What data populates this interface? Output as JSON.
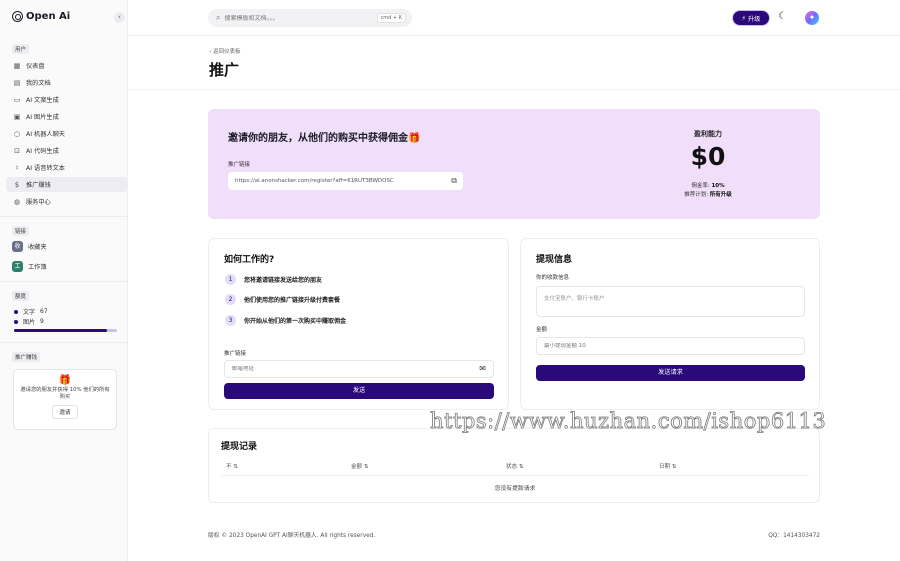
{
  "app": {
    "logo_text": "Open Ai"
  },
  "sidebar": {
    "section_user": "用户",
    "items": [
      {
        "label": "仪表盘",
        "icon": "grid-icon"
      },
      {
        "label": "我的文档",
        "icon": "archive-icon"
      },
      {
        "label": "AI 文案生成",
        "icon": "document-icon"
      },
      {
        "label": "AI 图片生成",
        "icon": "image-icon"
      },
      {
        "label": "AI 机器人聊天",
        "icon": "chat-icon"
      },
      {
        "label": "AI 代码生成",
        "icon": "code-icon"
      },
      {
        "label": "AI 语音转文本",
        "icon": "mic-icon"
      },
      {
        "label": "推广赚钱",
        "icon": "dollar-icon",
        "active": true
      },
      {
        "label": "服务中心",
        "icon": "globe-icon"
      }
    ],
    "section_workspace": "链接",
    "workspace": [
      {
        "label": "收藏夹",
        "initial": "收",
        "color": "#6a6f8a"
      },
      {
        "label": "工作簿",
        "initial": "工",
        "color": "#2f7f6e"
      }
    ],
    "section_usage": "额度",
    "usage": {
      "words_label": "文字",
      "words_value": "67",
      "images_label": "图片",
      "images_value": "9",
      "fill_fraction": 0.9
    },
    "section_promo": "推广赚钱",
    "promo": {
      "text": "邀请您的朋友并获得 10% 他们的所有购买",
      "button": "邀请"
    }
  },
  "topbar": {
    "search_placeholder": "搜索模板和文档。。。",
    "shortcut": "cmd + K",
    "upgrade_label": "升级"
  },
  "page": {
    "back_link": "返回仪表板",
    "title": "推广"
  },
  "hero": {
    "title": "邀请你的朋友，从他们的购买中获得佣金🎁",
    "link_label": "推广链接",
    "link_value": "https://ai.anonshacker.com/register?aff=61RUT3BWDOSC",
    "earnings_label": "盈利能力",
    "earnings_value": "$0",
    "rate_label": "佣金率:",
    "rate_value": "10%",
    "plan_label": "推荐计划:",
    "plan_value": "所有升级"
  },
  "how": {
    "title": "如何工作的?",
    "steps": [
      {
        "num": "1",
        "text": "您将邀请链接发送给您的朋友"
      },
      {
        "num": "2",
        "text": "他们使用您的推广链接升级付费套餐"
      },
      {
        "num": "3",
        "text": "你开始从他们的第一次购买中赚取佣金"
      }
    ],
    "email_label": "推广链接",
    "email_placeholder": "邮箱地址",
    "send_button": "发送"
  },
  "withdraw": {
    "title": "提现信息",
    "payment_label": "你的收款信息",
    "payment_placeholder": "支付宝账户、银行卡账户",
    "amount_label": "金额",
    "amount_placeholder": "最小提现金额 10",
    "submit_button": "发送请求"
  },
  "records": {
    "title": "提现记录",
    "columns": [
      "不",
      "金额",
      "状态",
      "日期"
    ],
    "empty_text": "您没有提款请求"
  },
  "footer": {
    "copyright": "版权 © 2023 OpenAI GPT AI聊天机器人. All rights reserved.",
    "contact": "QQ：1414303472"
  },
  "watermark": "https://www.huzhan.com/ishop6113",
  "colors": {
    "accent": "#2a0a7a",
    "hero_bg": "#f0defa"
  }
}
